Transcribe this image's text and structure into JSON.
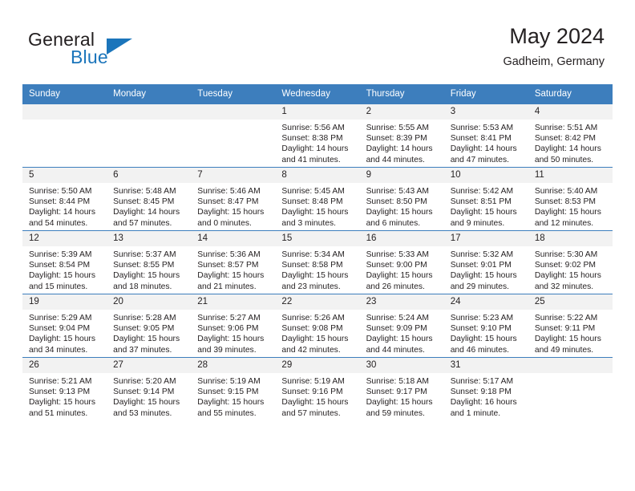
{
  "brand": {
    "name_part1": "General",
    "name_part2": "Blue",
    "logo_icon": "blue-triangle-icon",
    "accent_color": "#1b75bb"
  },
  "header": {
    "title": "May 2024",
    "subtitle": "Gadheim, Germany"
  },
  "colors": {
    "header_row": "#3d7ebd",
    "day_number_bg": "#f2f2f2",
    "text": "#231f20",
    "grid_line": "#3d7ebd"
  },
  "weekday_headers": [
    "Sunday",
    "Monday",
    "Tuesday",
    "Wednesday",
    "Thursday",
    "Friday",
    "Saturday"
  ],
  "labels": {
    "sunrise_prefix": "Sunrise:",
    "sunset_prefix": "Sunset:",
    "daylight_prefix": "Daylight:"
  },
  "weeks": [
    [
      {
        "day": "",
        "sunrise": "",
        "sunset": "",
        "daylight_line1": "",
        "daylight_line2": ""
      },
      {
        "day": "",
        "sunrise": "",
        "sunset": "",
        "daylight_line1": "",
        "daylight_line2": ""
      },
      {
        "day": "",
        "sunrise": "",
        "sunset": "",
        "daylight_line1": "",
        "daylight_line2": ""
      },
      {
        "day": "1",
        "sunrise": "Sunrise: 5:56 AM",
        "sunset": "Sunset: 8:38 PM",
        "daylight_line1": "Daylight: 14 hours",
        "daylight_line2": "and 41 minutes."
      },
      {
        "day": "2",
        "sunrise": "Sunrise: 5:55 AM",
        "sunset": "Sunset: 8:39 PM",
        "daylight_line1": "Daylight: 14 hours",
        "daylight_line2": "and 44 minutes."
      },
      {
        "day": "3",
        "sunrise": "Sunrise: 5:53 AM",
        "sunset": "Sunset: 8:41 PM",
        "daylight_line1": "Daylight: 14 hours",
        "daylight_line2": "and 47 minutes."
      },
      {
        "day": "4",
        "sunrise": "Sunrise: 5:51 AM",
        "sunset": "Sunset: 8:42 PM",
        "daylight_line1": "Daylight: 14 hours",
        "daylight_line2": "and 50 minutes."
      }
    ],
    [
      {
        "day": "5",
        "sunrise": "Sunrise: 5:50 AM",
        "sunset": "Sunset: 8:44 PM",
        "daylight_line1": "Daylight: 14 hours",
        "daylight_line2": "and 54 minutes."
      },
      {
        "day": "6",
        "sunrise": "Sunrise: 5:48 AM",
        "sunset": "Sunset: 8:45 PM",
        "daylight_line1": "Daylight: 14 hours",
        "daylight_line2": "and 57 minutes."
      },
      {
        "day": "7",
        "sunrise": "Sunrise: 5:46 AM",
        "sunset": "Sunset: 8:47 PM",
        "daylight_line1": "Daylight: 15 hours",
        "daylight_line2": "and 0 minutes."
      },
      {
        "day": "8",
        "sunrise": "Sunrise: 5:45 AM",
        "sunset": "Sunset: 8:48 PM",
        "daylight_line1": "Daylight: 15 hours",
        "daylight_line2": "and 3 minutes."
      },
      {
        "day": "9",
        "sunrise": "Sunrise: 5:43 AM",
        "sunset": "Sunset: 8:50 PM",
        "daylight_line1": "Daylight: 15 hours",
        "daylight_line2": "and 6 minutes."
      },
      {
        "day": "10",
        "sunrise": "Sunrise: 5:42 AM",
        "sunset": "Sunset: 8:51 PM",
        "daylight_line1": "Daylight: 15 hours",
        "daylight_line2": "and 9 minutes."
      },
      {
        "day": "11",
        "sunrise": "Sunrise: 5:40 AM",
        "sunset": "Sunset: 8:53 PM",
        "daylight_line1": "Daylight: 15 hours",
        "daylight_line2": "and 12 minutes."
      }
    ],
    [
      {
        "day": "12",
        "sunrise": "Sunrise: 5:39 AM",
        "sunset": "Sunset: 8:54 PM",
        "daylight_line1": "Daylight: 15 hours",
        "daylight_line2": "and 15 minutes."
      },
      {
        "day": "13",
        "sunrise": "Sunrise: 5:37 AM",
        "sunset": "Sunset: 8:55 PM",
        "daylight_line1": "Daylight: 15 hours",
        "daylight_line2": "and 18 minutes."
      },
      {
        "day": "14",
        "sunrise": "Sunrise: 5:36 AM",
        "sunset": "Sunset: 8:57 PM",
        "daylight_line1": "Daylight: 15 hours",
        "daylight_line2": "and 21 minutes."
      },
      {
        "day": "15",
        "sunrise": "Sunrise: 5:34 AM",
        "sunset": "Sunset: 8:58 PM",
        "daylight_line1": "Daylight: 15 hours",
        "daylight_line2": "and 23 minutes."
      },
      {
        "day": "16",
        "sunrise": "Sunrise: 5:33 AM",
        "sunset": "Sunset: 9:00 PM",
        "daylight_line1": "Daylight: 15 hours",
        "daylight_line2": "and 26 minutes."
      },
      {
        "day": "17",
        "sunrise": "Sunrise: 5:32 AM",
        "sunset": "Sunset: 9:01 PM",
        "daylight_line1": "Daylight: 15 hours",
        "daylight_line2": "and 29 minutes."
      },
      {
        "day": "18",
        "sunrise": "Sunrise: 5:30 AM",
        "sunset": "Sunset: 9:02 PM",
        "daylight_line1": "Daylight: 15 hours",
        "daylight_line2": "and 32 minutes."
      }
    ],
    [
      {
        "day": "19",
        "sunrise": "Sunrise: 5:29 AM",
        "sunset": "Sunset: 9:04 PM",
        "daylight_line1": "Daylight: 15 hours",
        "daylight_line2": "and 34 minutes."
      },
      {
        "day": "20",
        "sunrise": "Sunrise: 5:28 AM",
        "sunset": "Sunset: 9:05 PM",
        "daylight_line1": "Daylight: 15 hours",
        "daylight_line2": "and 37 minutes."
      },
      {
        "day": "21",
        "sunrise": "Sunrise: 5:27 AM",
        "sunset": "Sunset: 9:06 PM",
        "daylight_line1": "Daylight: 15 hours",
        "daylight_line2": "and 39 minutes."
      },
      {
        "day": "22",
        "sunrise": "Sunrise: 5:26 AM",
        "sunset": "Sunset: 9:08 PM",
        "daylight_line1": "Daylight: 15 hours",
        "daylight_line2": "and 42 minutes."
      },
      {
        "day": "23",
        "sunrise": "Sunrise: 5:24 AM",
        "sunset": "Sunset: 9:09 PM",
        "daylight_line1": "Daylight: 15 hours",
        "daylight_line2": "and 44 minutes."
      },
      {
        "day": "24",
        "sunrise": "Sunrise: 5:23 AM",
        "sunset": "Sunset: 9:10 PM",
        "daylight_line1": "Daylight: 15 hours",
        "daylight_line2": "and 46 minutes."
      },
      {
        "day": "25",
        "sunrise": "Sunrise: 5:22 AM",
        "sunset": "Sunset: 9:11 PM",
        "daylight_line1": "Daylight: 15 hours",
        "daylight_line2": "and 49 minutes."
      }
    ],
    [
      {
        "day": "26",
        "sunrise": "Sunrise: 5:21 AM",
        "sunset": "Sunset: 9:13 PM",
        "daylight_line1": "Daylight: 15 hours",
        "daylight_line2": "and 51 minutes."
      },
      {
        "day": "27",
        "sunrise": "Sunrise: 5:20 AM",
        "sunset": "Sunset: 9:14 PM",
        "daylight_line1": "Daylight: 15 hours",
        "daylight_line2": "and 53 minutes."
      },
      {
        "day": "28",
        "sunrise": "Sunrise: 5:19 AM",
        "sunset": "Sunset: 9:15 PM",
        "daylight_line1": "Daylight: 15 hours",
        "daylight_line2": "and 55 minutes."
      },
      {
        "day": "29",
        "sunrise": "Sunrise: 5:19 AM",
        "sunset": "Sunset: 9:16 PM",
        "daylight_line1": "Daylight: 15 hours",
        "daylight_line2": "and 57 minutes."
      },
      {
        "day": "30",
        "sunrise": "Sunrise: 5:18 AM",
        "sunset": "Sunset: 9:17 PM",
        "daylight_line1": "Daylight: 15 hours",
        "daylight_line2": "and 59 minutes."
      },
      {
        "day": "31",
        "sunrise": "Sunrise: 5:17 AM",
        "sunset": "Sunset: 9:18 PM",
        "daylight_line1": "Daylight: 16 hours",
        "daylight_line2": "and 1 minute."
      },
      {
        "day": "",
        "sunrise": "",
        "sunset": "",
        "daylight_line1": "",
        "daylight_line2": ""
      }
    ]
  ]
}
